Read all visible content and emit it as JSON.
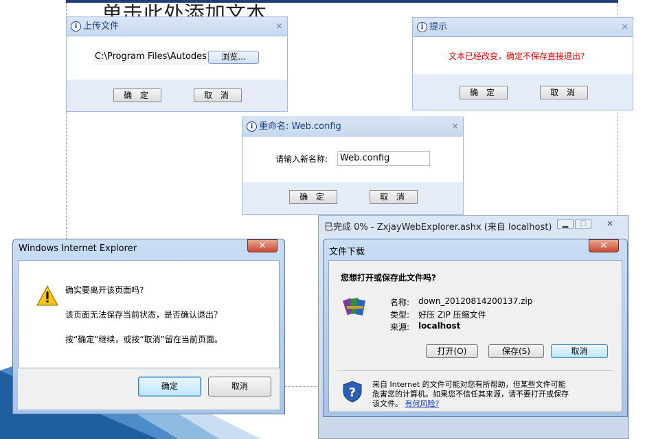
{
  "slide": {
    "bg_title": "单击此处添加文本"
  },
  "upload": {
    "title": "上传文件",
    "close": "×",
    "path_value": "C:\\Program Files\\Autodes",
    "browse": "浏览...",
    "ok": "确 定",
    "cancel": "取 消"
  },
  "prompt": {
    "title": "提示",
    "close": "×",
    "message": "文本已经改变，确定不保存直接退出?",
    "ok": "确 定",
    "cancel": "取 消"
  },
  "rename": {
    "title": "重命名: Web.config",
    "close": "×",
    "label": "请输入新名称:",
    "value": "Web.config",
    "ok": "确 定",
    "cancel": "取 消"
  },
  "ie_dialog": {
    "title": "Windows Internet Explorer",
    "close": "✕",
    "question": "确实要离开该页面吗?",
    "line2": "该页面无法保存当前状态，是否确认退出？",
    "line3": "按“确定”继续，或按“取消”留在当前页面。",
    "ok": "确定",
    "cancel": "取消"
  },
  "download": {
    "outer_title": "已完成 0% - ZxjayWebExplorer.ashx (来自 localhost)",
    "title": "文件下载",
    "close": "✕",
    "question": "您想打开或保存此文件吗?",
    "name_label": "名称:",
    "name_value": "down_20120814200137.zip",
    "type_label": "类型:",
    "type_value": "好压 ZIP 压缩文件",
    "from_label": "来源:",
    "from_value": "localhost",
    "open": "打开(O)",
    "save": "保存(S)",
    "cancel": "取消",
    "warning_line1": "来自 Internet 的文件可能对您有所帮助，但某些文件可能",
    "warning_line2": "危害您的计算机。如果您不信任其来源，请不要打开或保存",
    "warning_line3": "该文件。",
    "risk_link": "有何风险?"
  },
  "colors": {
    "warning_red": "#e00000",
    "ext_title": "#15428b",
    "link_blue": "#0033cc"
  }
}
